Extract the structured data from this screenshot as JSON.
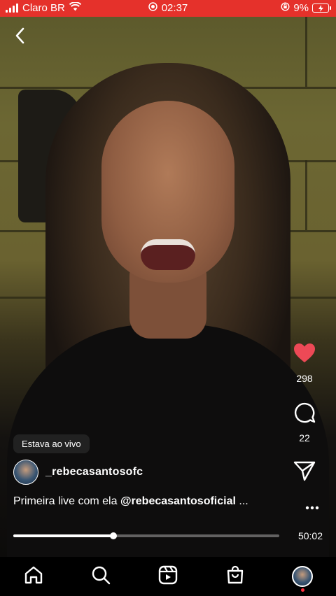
{
  "status_bar": {
    "carrier": "Claro BR",
    "time": "02:37",
    "battery": "9%",
    "colors": {
      "background": "#e5312b"
    },
    "icons": [
      "signal-icon",
      "wifi-icon",
      "recording-icon",
      "rotation-lock-icon",
      "battery-charging-icon"
    ]
  },
  "live": {
    "label": "Estava ao vivo"
  },
  "actions": {
    "likes": "298",
    "comments": "22",
    "icons": [
      "heart-icon",
      "comment-icon",
      "share-icon",
      "more-icon"
    ],
    "like_color": "#ed4956"
  },
  "author": {
    "username": "_rebecasantosofc"
  },
  "caption": {
    "text": "Primeira live com ela ",
    "mention": "@rebecasantosoficial",
    "ellipsis": " ..."
  },
  "player": {
    "progress": 0.375,
    "duration": "50:02"
  },
  "nav": {
    "icons": [
      "home-icon",
      "search-icon",
      "reels-icon",
      "shop-icon",
      "profile-avatar"
    ]
  }
}
